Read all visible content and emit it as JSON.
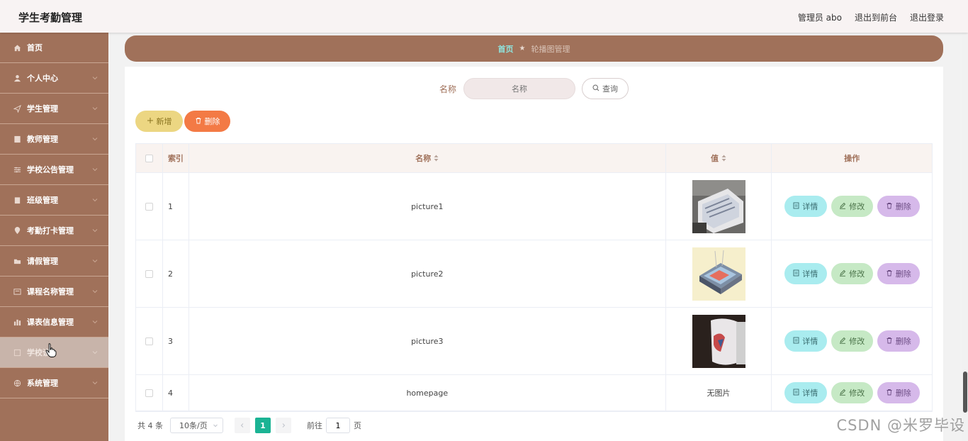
{
  "header": {
    "title": "学生考勤管理",
    "user": "管理员 abo",
    "to_front": "退出到前台",
    "logout": "退出登录"
  },
  "sidebar": {
    "items": [
      {
        "label": "首页",
        "icon": "home-icon"
      },
      {
        "label": "个人中心",
        "icon": "user-icon"
      },
      {
        "label": "学生管理",
        "icon": "send-icon"
      },
      {
        "label": "教师管理",
        "icon": "document-icon"
      },
      {
        "label": "学校公告管理",
        "icon": "sliders-icon"
      },
      {
        "label": "班级管理",
        "icon": "clipboard-icon"
      },
      {
        "label": "考勤打卡管理",
        "icon": "location-icon"
      },
      {
        "label": "请假管理",
        "icon": "folder-icon"
      },
      {
        "label": "课程名称管理",
        "icon": "message-icon"
      },
      {
        "label": "课表信息管理",
        "icon": "chart-icon"
      },
      {
        "label": "学校设",
        "icon": "square-icon"
      },
      {
        "label": "系统管理",
        "icon": "globe-icon"
      }
    ]
  },
  "breadcrumb": {
    "home": "首页",
    "separator": "★",
    "current": "轮播图管理"
  },
  "search": {
    "label": "名称",
    "placeholder": "名称",
    "button": "查询"
  },
  "actions": {
    "add": "新增",
    "delete": "删除"
  },
  "table": {
    "headers": {
      "index": "索引",
      "name": "名称",
      "value": "值",
      "ops": "操作"
    },
    "rows": [
      {
        "index": "1",
        "name": "picture1",
        "value": ""
      },
      {
        "index": "2",
        "name": "picture2",
        "value": ""
      },
      {
        "index": "3",
        "name": "picture3",
        "value": ""
      },
      {
        "index": "4",
        "name": "homepage",
        "value": "无图片"
      }
    ],
    "op_labels": {
      "detail": "详情",
      "edit": "修改",
      "delete": "删除"
    }
  },
  "pagination": {
    "total": "共 4 条",
    "page_size": "10条/页",
    "current_page": "1",
    "goto_prefix": "前往",
    "goto_value": "1",
    "goto_suffix": "页"
  },
  "watermark": "CSDN @米罗毕设",
  "colors": {
    "sidebar": "#a0715a",
    "accent_green": "#1bb394",
    "add_button": "#ecd682",
    "delete_button": "#f37a45"
  }
}
